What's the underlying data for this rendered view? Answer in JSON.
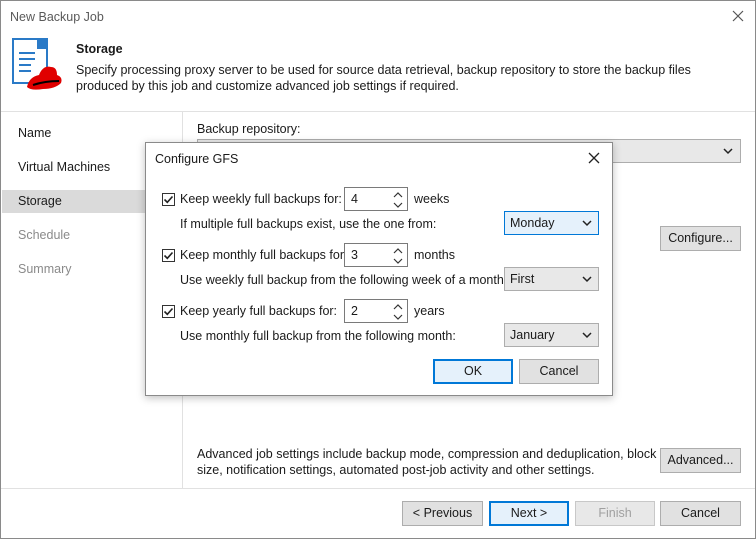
{
  "window": {
    "title": "New Backup Job"
  },
  "header": {
    "title": "Storage",
    "description": "Specify processing proxy server to be used for source data retrieval, backup repository to store the backup files produced by this job and customize advanced job settings if required."
  },
  "sidebar": {
    "items": [
      {
        "label": "Name"
      },
      {
        "label": "Virtual Machines"
      },
      {
        "label": "Storage"
      },
      {
        "label": "Schedule"
      },
      {
        "label": "Summary"
      }
    ]
  },
  "main": {
    "repo_label": "Backup repository:",
    "configure_label": "Configure...",
    "advanced_text": "Advanced job settings include backup mode, compression and deduplication, block size, notification settings, automated post-job activity and other settings.",
    "advanced_label": "Advanced..."
  },
  "footer": {
    "previous": "< Previous",
    "next": "Next >",
    "finish": "Finish",
    "cancel": "Cancel"
  },
  "dialog": {
    "title": "Configure GFS",
    "weekly": {
      "label": "Keep weekly full backups for:",
      "value": "4",
      "unit": "weeks",
      "sub_label": "If multiple full backups exist, use the one from:",
      "sub_value": "Monday"
    },
    "monthly": {
      "label": "Keep monthly full backups for:",
      "value": "3",
      "unit": "months",
      "sub_label": "Use weekly full backup from the following week of a month:",
      "sub_value": "First"
    },
    "yearly": {
      "label": "Keep yearly full backups for:",
      "value": "2",
      "unit": "years",
      "sub_label": "Use monthly full backup from the following month:",
      "sub_value": "January"
    },
    "ok": "OK",
    "cancel": "Cancel"
  },
  "colors": {
    "accent": "#0078d7",
    "selected_bg": "#dadada",
    "button_bg": "#e1e1e1",
    "logo_red": "#e00000"
  }
}
